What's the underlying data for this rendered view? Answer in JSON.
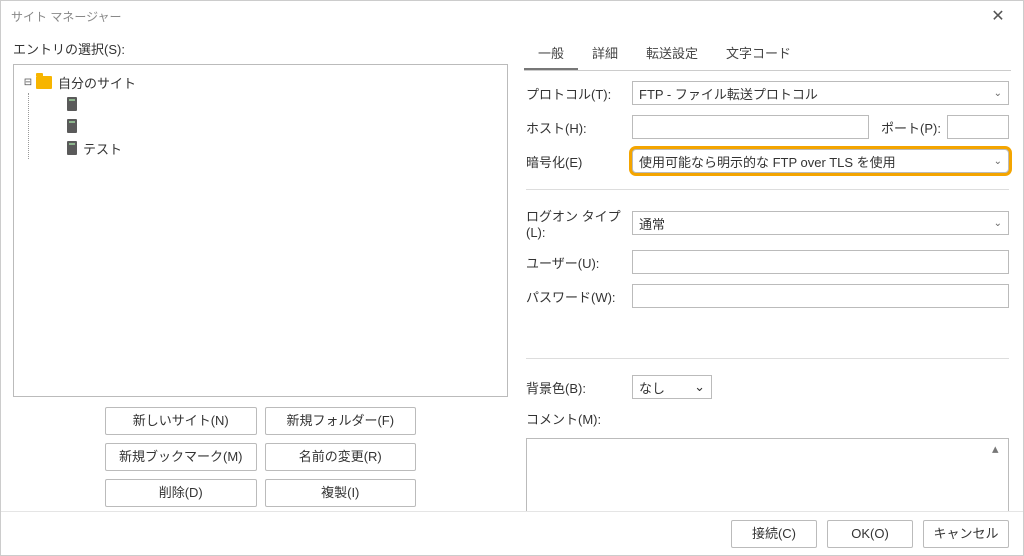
{
  "window": {
    "title": "サイト マネージャー"
  },
  "left": {
    "entry_label": "エントリの選択(S):",
    "tree": {
      "root": "自分のサイト",
      "children": [
        "",
        "",
        "テスト"
      ]
    },
    "buttons": {
      "new_site": "新しいサイト(N)",
      "new_folder": "新規フォルダー(F)",
      "new_bookmark": "新規ブックマーク(M)",
      "rename": "名前の変更(R)",
      "delete": "削除(D)",
      "duplicate": "複製(I)"
    }
  },
  "tabs": {
    "general": "一般",
    "advanced": "詳細",
    "transfer": "転送設定",
    "charset": "文字コード"
  },
  "form": {
    "protocol_label": "プロトコル(T):",
    "protocol_value": "FTP - ファイル転送プロトコル",
    "host_label": "ホスト(H):",
    "host_value": "",
    "port_label": "ポート(P):",
    "port_value": "",
    "encryption_label": "暗号化(E)",
    "encryption_value": "使用可能なら明示的な FTP over TLS を使用",
    "logon_label": "ログオン タイプ(L):",
    "logon_value": "通常",
    "user_label": "ユーザー(U):",
    "user_value": "",
    "password_label": "パスワード(W):",
    "password_value": "",
    "bgcolor_label": "背景色(B):",
    "bgcolor_value": "なし",
    "comment_label": "コメント(M):",
    "comment_value": ""
  },
  "footer": {
    "connect": "接続(C)",
    "ok": "OK(O)",
    "cancel": "キャンセル"
  }
}
